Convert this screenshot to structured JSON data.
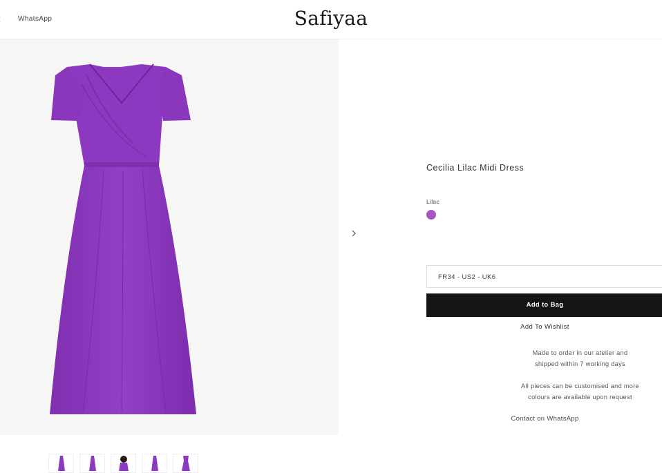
{
  "header": {
    "nav_link": "WhatsApp",
    "logo": "Safiyaa"
  },
  "gallery": {
    "main_image_alt": "Cecilia Lilac Midi Dress",
    "thumbnail_count": 5,
    "dress_color": "#8e38bf"
  },
  "product": {
    "title": "Cecilia Lilac Midi Dress",
    "colour_label": "Lilac",
    "swatch_color": "#a557c8",
    "size_selected": "FR34 - US2 - UK6",
    "add_to_bag": "Add to Bag",
    "add_to_wishlist": "Add To Wishlist",
    "note_made_to_order": [
      "Made to order in our atelier and",
      "shipped within 7 working days"
    ],
    "note_customise": [
      "All pieces can be customised and more",
      "colours are available upon request"
    ],
    "contact_link": "Contact on WhatsApp"
  },
  "colors": {
    "button_bg": "#151515",
    "gallery_bg": "#f6f6f5"
  }
}
